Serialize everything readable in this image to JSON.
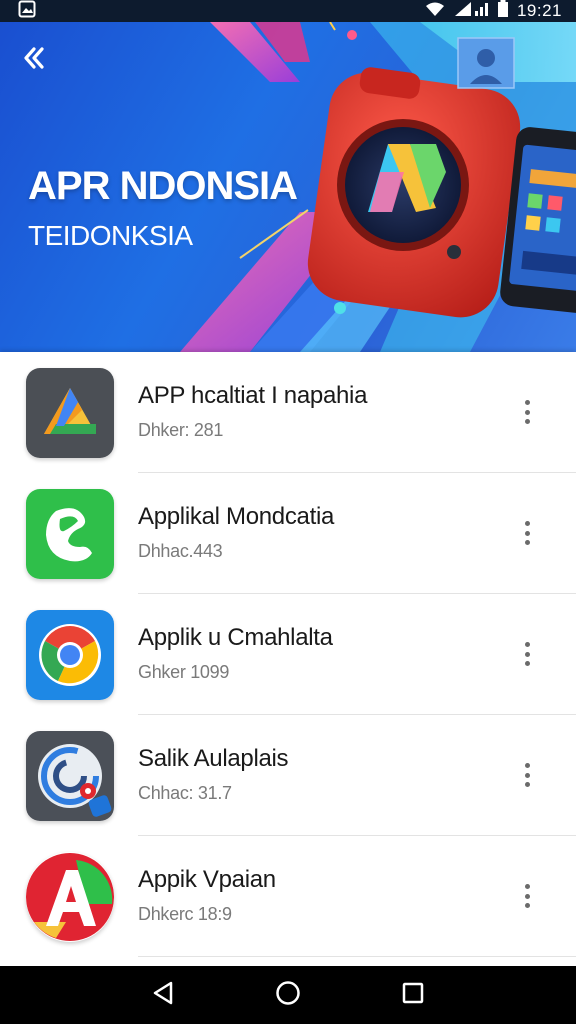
{
  "status_bar": {
    "time": "19:21",
    "icons": [
      "gallery-icon",
      "wifi-icon",
      "signal-icon",
      "battery-icon"
    ]
  },
  "hero": {
    "title": "APR NDONSIA",
    "subtitle": "TEIDONKSIA",
    "back_icon": "back-chevron-icon",
    "colors": {
      "background": "#1f6fe4",
      "device": "#d9342b",
      "accent_pink": "#ff4fa0",
      "accent_cyan": "#5fe0f0"
    }
  },
  "apps": [
    {
      "name": "APP hcaltiat I napahia",
      "meta": "Dhker: 281",
      "icon": "triangle-app-icon"
    },
    {
      "name": "Applikal Mondcatia",
      "meta": "Dhhac.443",
      "icon": "phone-app-icon"
    },
    {
      "name": "Applik u Cmahlalta",
      "meta": "Ghker 1099",
      "icon": "chrome-app-icon"
    },
    {
      "name": "Salik Aulaplais",
      "meta": "Chhac: 31.7",
      "icon": "c-ring-app-icon"
    },
    {
      "name": "Appik Vpaian",
      "meta": "Dhkerc 18:9",
      "icon": "letter-a-app-icon"
    }
  ],
  "more_icon": "more-vert-icon",
  "nav_bar": {
    "buttons": [
      "back-triangle-icon",
      "home-circle-icon",
      "recents-square-icon"
    ]
  }
}
